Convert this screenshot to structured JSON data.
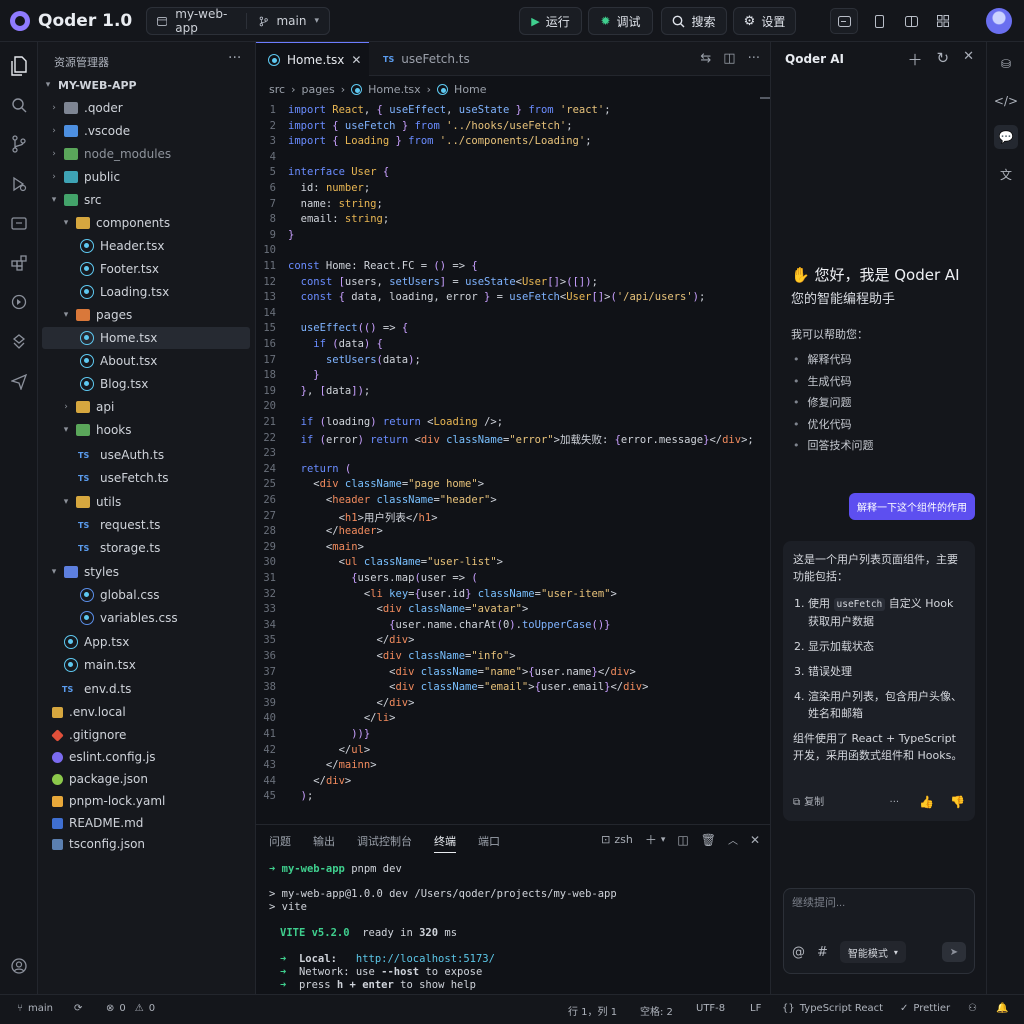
{
  "app": {
    "name": "Qoder 1.0"
  },
  "titlebar": {
    "project": "my-web-app",
    "branch": "main",
    "run_label": "运行",
    "debug_label": "调试",
    "search_label": "搜索",
    "settings_label": "设置"
  },
  "explorer": {
    "title": "资源管理器",
    "root": "MY-WEB-APP",
    "items": [
      {
        "label": ".qoder"
      },
      {
        "label": ".vscode"
      },
      {
        "label": "node_modules"
      },
      {
        "label": "public"
      },
      {
        "label": "src"
      },
      {
        "label": "components"
      },
      {
        "label": "Header.tsx"
      },
      {
        "label": "Footer.tsx"
      },
      {
        "label": "Loading.tsx"
      },
      {
        "label": "pages"
      },
      {
        "label": "Home.tsx"
      },
      {
        "label": "About.tsx"
      },
      {
        "label": "Blog.tsx"
      },
      {
        "label": "api"
      },
      {
        "label": "hooks"
      },
      {
        "label": "useAuth.ts"
      },
      {
        "label": "useFetch.ts"
      },
      {
        "label": "utils"
      },
      {
        "label": "request.ts"
      },
      {
        "label": "storage.ts"
      },
      {
        "label": "styles"
      },
      {
        "label": "global.css"
      },
      {
        "label": "variables.css"
      },
      {
        "label": "App.tsx"
      },
      {
        "label": "main.tsx"
      },
      {
        "label": "env.d.ts"
      },
      {
        "label": ".env.local"
      },
      {
        "label": ".gitignore"
      },
      {
        "label": "eslint.config.js"
      },
      {
        "label": "package.json"
      },
      {
        "label": "pnpm-lock.yaml"
      },
      {
        "label": "README.md"
      },
      {
        "label": "tsconfig.json"
      }
    ]
  },
  "editor": {
    "tabs": [
      {
        "label": "Home.tsx",
        "badge": ""
      },
      {
        "label": "useFetch.ts",
        "badge": "TS"
      }
    ],
    "breadcrumb": [
      "src",
      "pages",
      "Home.tsx",
      "Home"
    ],
    "lines": [
      "import React, { useEffect, useState } from 'react';",
      "import { useFetch } from '../hooks/useFetch';",
      "import { Loading } from '../components/Loading';",
      "",
      "interface User {",
      "  id: number;",
      "  name: string;",
      "  email: string;",
      "}",
      "",
      "const Home: React.FC = () => {",
      "  const [users, setUsers] = useState<User[]>([]);",
      "  const { data, loading, error } = useFetch<User[]>('/api/users');",
      "",
      "  useEffect(() => {",
      "    if (data) {",
      "      setUsers(data);",
      "    }",
      "  }, [data]);",
      "",
      "  if (loading) return <Loading />;",
      "  if (error) return <div className=\"error\">加载失败: {error.message}</div>;",
      "",
      "  return (",
      "    <div className=\"page home\">",
      "      <header className=\"header\">",
      "        <h1>用户列表</h1>",
      "      </header>",
      "      <main>",
      "        <ul className=\"user-list\">",
      "          {users.map(user => (",
      "            <li key={user.id} className=\"user-item\">",
      "              <div className=\"avatar\">",
      "                {user.name.charAt(0).toUpperCase()}",
      "              </div>",
      "              <div className=\"info\">",
      "                <div className=\"name\">{user.name}</div>",
      "                <div className=\"email\">{user.email}</div>",
      "              </div>",
      "            </li>",
      "          ))}",
      "        </ul>",
      "      </mainn>",
      "    </div>",
      "  );"
    ]
  },
  "panel": {
    "tabs": [
      "问题",
      "输出",
      "调试控制台",
      "终端",
      "端口"
    ],
    "shell": "zsh",
    "terminal": {
      "prompt_dir": "my-web-app",
      "prompt_cmd": "pnpm dev",
      "line1": "> my-web-app@1.0.0 dev /Users/qoder/projects/my-web-app",
      "line2": "> vite",
      "vite_name": "VITE v5.2.0",
      "ready_text": "ready in",
      "ready_ms": "320",
      "ready_unit": "ms",
      "local_label": "Local:",
      "local_url": "http://localhost:5173/",
      "network_label": "Network: use",
      "network_flag": "--host",
      "network_tail": "to expose",
      "help_press": "press",
      "help_keys": "h + enter",
      "help_tail": "to show help"
    }
  },
  "ai": {
    "title": "Qoder AI",
    "greeting": "您好，我是 Qoder AI",
    "subtitle": "您的智能编程助手",
    "help_intro": "我可以帮助您：",
    "capabilities": [
      "解释代码",
      "生成代码",
      "修复问题",
      "优化代码",
      "回答技术问题"
    ],
    "user_message": "解释一下这个组件的作用",
    "reply_intro": "这是一个用户列表页面组件，主要功能包括：",
    "reply_items": [
      {
        "pre": "使用",
        "code": "useFetch",
        "post": "自定义 Hook 获取用户数据"
      },
      {
        "pre": "显示加载状态",
        "code": "",
        "post": ""
      },
      {
        "pre": "错误处理",
        "code": "",
        "post": ""
      },
      {
        "pre": "渲染用户列表，包含用户头像、姓名和邮箱",
        "code": "",
        "post": ""
      }
    ],
    "reply_outro": "组件使用了 React + TypeScript 开发，采用函数式组件和 Hooks。",
    "copy_label": "复制",
    "input_placeholder": "继续提问...",
    "mode_label": "智能模式"
  },
  "status": {
    "branch": "main",
    "errors": "0",
    "warnings": "0",
    "position": "行 1，列 1",
    "spaces": "空格: 2",
    "encoding": "UTF-8",
    "eol": "LF",
    "language": "TypeScript React",
    "formatter": "Prettier"
  },
  "colors": {
    "accent": "#5d4ff0",
    "brand": "#8f7bff"
  }
}
